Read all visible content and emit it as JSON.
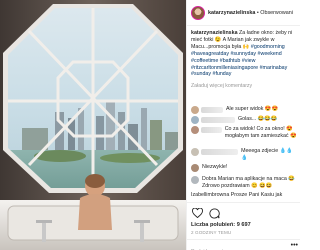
{
  "header": {
    "username": "katarzynazielinska",
    "separator": " • ",
    "follow_label": "Obserwowani"
  },
  "caption": {
    "username": "katarzynazielinska",
    "text": " Za ładne okno: żeby ni mieć fotki 😉 A Marian jak zwykle w Macu...promocja była 🙌 ",
    "hashtags": "#goodmorning #haveagreatday #sunnyday #weekend #coffeetime #bathtub #view #ritzcarltonmilleniasingapore #marinabay #sunday #funday"
  },
  "more_comments_label": "Załaduj więcej komentarzy",
  "comments": [
    {
      "text": "Ale super widok 😍😍"
    },
    {
      "text": "Golas... 😂😂😂"
    },
    {
      "text": "Co za widok! Co za okno! 😍 mogłabym tam zamieszkać 😍"
    },
    {
      "text": "Meeega zdjecie 💧💧💧"
    },
    {
      "text": "Niezwykle!"
    },
    {
      "text": "Dobra Marian ma aplikacje na maca 😂 Zdrowo pozdrawiam 😊 😆😆"
    },
    {
      "text": "Izabellimbrowna Prosze Pani Kasiu jak"
    }
  ],
  "likes": {
    "label": "Liczba polubień: ",
    "count": "9 697"
  },
  "date": "2 GODZINY TEMU",
  "add_comment_placeholder": "Dodaj komentarz...",
  "more_options_label": "•••",
  "colors": {
    "link": "#003569",
    "muted": "#999999",
    "text": "#262626",
    "border": "#efefef"
  },
  "icons": [
    "heart-icon",
    "comment-icon",
    "more-options-icon"
  ]
}
